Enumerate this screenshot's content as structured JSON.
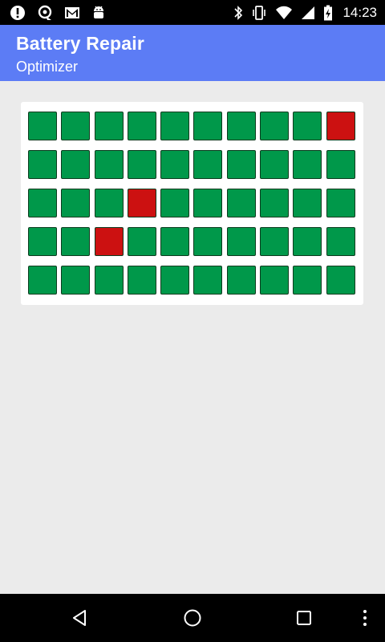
{
  "status_bar": {
    "time": "14:23",
    "left_icons": [
      "alert-icon",
      "sync-icon",
      "gmail-icon",
      "android-debug-icon"
    ],
    "right_icons": [
      "bluetooth-icon",
      "vibrate-icon",
      "wifi-icon",
      "signal-icon",
      "battery-charging-icon"
    ]
  },
  "app_bar": {
    "title": "Battery Repair",
    "subtitle": "Optimizer",
    "background_color": "#5c7cf5"
  },
  "grid": {
    "rows": 5,
    "columns": 10,
    "ok_color": "#00984a",
    "bad_color": "#cc1111",
    "cells": [
      [
        "ok",
        "ok",
        "ok",
        "ok",
        "ok",
        "ok",
        "ok",
        "ok",
        "ok",
        "bad"
      ],
      [
        "ok",
        "ok",
        "ok",
        "ok",
        "ok",
        "ok",
        "ok",
        "ok",
        "ok",
        "ok"
      ],
      [
        "ok",
        "ok",
        "ok",
        "bad",
        "ok",
        "ok",
        "ok",
        "ok",
        "ok",
        "ok"
      ],
      [
        "ok",
        "ok",
        "bad",
        "ok",
        "ok",
        "ok",
        "ok",
        "ok",
        "ok",
        "ok"
      ],
      [
        "ok",
        "ok",
        "ok",
        "ok",
        "ok",
        "ok",
        "ok",
        "ok",
        "ok",
        "ok"
      ]
    ]
  },
  "nav_bar": {
    "buttons": [
      "back-icon",
      "home-icon",
      "recents-icon",
      "overflow-menu-icon"
    ]
  }
}
